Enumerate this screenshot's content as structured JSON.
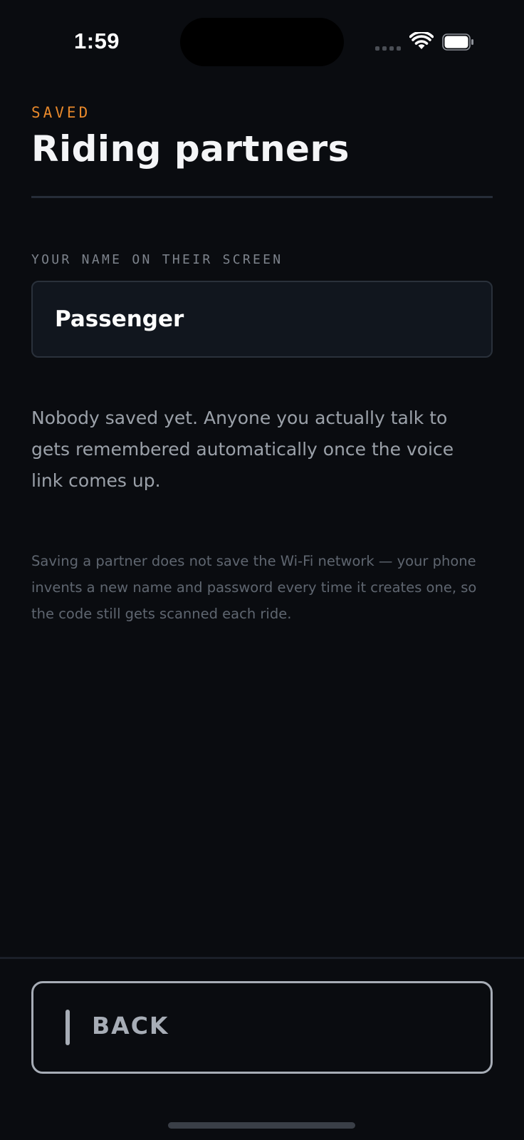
{
  "status_bar": {
    "time": "1:59",
    "icons": [
      "cellular-signal-icon",
      "wifi-icon",
      "battery-icon"
    ]
  },
  "header": {
    "eyebrow": "SAVED",
    "title": "Riding partners"
  },
  "name_field": {
    "label": "YOUR NAME ON THEIR SCREEN",
    "value": "Passenger"
  },
  "partners": {
    "empty_message": "Nobody saved yet. Anyone you actually talk to gets remembered automatically once the voice link comes up."
  },
  "footnote": "Saving a partner does not save the Wi-Fi network — your phone invents a new name and password every time it creates one, so the code still gets scanned each ride.",
  "footer": {
    "back_label": "BACK"
  },
  "colors": {
    "background": "#0a0c10",
    "accent": "#e8892b",
    "input_background": "#11161e",
    "button_outline": "#a7adb6"
  }
}
